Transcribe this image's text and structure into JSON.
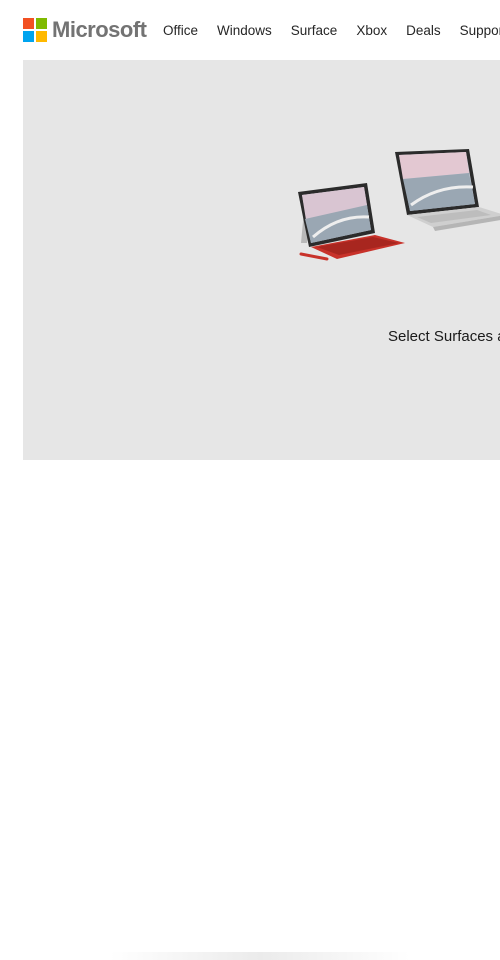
{
  "brand": {
    "name": "Microsoft",
    "logo_colors": [
      "#f25022",
      "#7fba00",
      "#00a4ef",
      "#ffb900"
    ]
  },
  "nav": {
    "items": [
      {
        "label": "Office"
      },
      {
        "label": "Windows"
      },
      {
        "label": "Surface"
      },
      {
        "label": "Xbox"
      },
      {
        "label": "Deals"
      },
      {
        "label": "Support"
      }
    ]
  },
  "hero": {
    "text": "Select Surfaces ar",
    "background": "#e6e6e6",
    "accent_color": "#c8322a"
  }
}
